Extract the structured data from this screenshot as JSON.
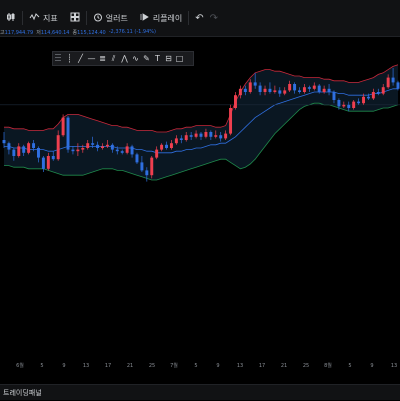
{
  "toolbar": {
    "indicators_label": "지표",
    "alerts_label": "얼러트",
    "replay_label": "리플레이"
  },
  "ohlc": {
    "open_label": "고",
    "open_value": "117,944.79",
    "low_label": "저",
    "low_value": "114,640.14",
    "close_label": "종",
    "close_value": "115,124.40",
    "change": "-2,376.11 (-1.94%)"
  },
  "bottom_panel": {
    "title": "트레이딩패널"
  },
  "colors": {
    "up": "#ef3f4f",
    "down": "#2f6fe0",
    "bb_upper": "#c8283a",
    "bb_lower": "#1f8a4c",
    "bb_basis": "#2f6fe0",
    "bb_fill": "#0b1a26"
  },
  "chart_data": {
    "type": "candlestick",
    "x_tick_labels": [
      "6월",
      "5",
      "9",
      "13",
      "17",
      "21",
      "25",
      "7월",
      "5",
      "9",
      "13",
      "17",
      "21",
      "25",
      "8월",
      "5",
      "9",
      "13"
    ],
    "candles": [
      {
        "o": 50,
        "c": 48,
        "h": 55,
        "l": 45
      },
      {
        "o": 48,
        "c": 44,
        "h": 49,
        "l": 41
      },
      {
        "o": 44,
        "c": 40,
        "h": 45,
        "l": 37
      },
      {
        "o": 40,
        "c": 46,
        "h": 48,
        "l": 39
      },
      {
        "o": 46,
        "c": 42,
        "h": 47,
        "l": 40
      },
      {
        "o": 42,
        "c": 48,
        "h": 49,
        "l": 41
      },
      {
        "o": 48,
        "c": 45,
        "h": 50,
        "l": 43
      },
      {
        "o": 45,
        "c": 39,
        "h": 46,
        "l": 36
      },
      {
        "o": 39,
        "c": 32,
        "h": 40,
        "l": 30
      },
      {
        "o": 32,
        "c": 40,
        "h": 42,
        "l": 31
      },
      {
        "o": 40,
        "c": 38,
        "h": 43,
        "l": 37
      },
      {
        "o": 38,
        "c": 53,
        "h": 56,
        "l": 37
      },
      {
        "o": 53,
        "c": 64,
        "h": 66,
        "l": 52
      },
      {
        "o": 64,
        "c": 44,
        "h": 65,
        "l": 42
      },
      {
        "o": 44,
        "c": 43,
        "h": 46,
        "l": 41
      },
      {
        "o": 43,
        "c": 44,
        "h": 48,
        "l": 40
      },
      {
        "o": 44,
        "c": 45,
        "h": 47,
        "l": 42
      },
      {
        "o": 45,
        "c": 48,
        "h": 50,
        "l": 44
      },
      {
        "o": 48,
        "c": 47,
        "h": 52,
        "l": 45
      },
      {
        "o": 47,
        "c": 45,
        "h": 49,
        "l": 43
      },
      {
        "o": 45,
        "c": 46,
        "h": 48,
        "l": 44
      },
      {
        "o": 46,
        "c": 47,
        "h": 50,
        "l": 45
      },
      {
        "o": 47,
        "c": 44,
        "h": 48,
        "l": 42
      },
      {
        "o": 44,
        "c": 43,
        "h": 46,
        "l": 41
      },
      {
        "o": 43,
        "c": 42,
        "h": 44,
        "l": 41
      },
      {
        "o": 42,
        "c": 46,
        "h": 48,
        "l": 41
      },
      {
        "o": 46,
        "c": 41,
        "h": 47,
        "l": 39
      },
      {
        "o": 41,
        "c": 36,
        "h": 42,
        "l": 35
      },
      {
        "o": 36,
        "c": 31,
        "h": 40,
        "l": 30
      },
      {
        "o": 31,
        "c": 28,
        "h": 33,
        "l": 24
      },
      {
        "o": 28,
        "c": 39,
        "h": 40,
        "l": 26
      },
      {
        "o": 39,
        "c": 44,
        "h": 46,
        "l": 38
      },
      {
        "o": 44,
        "c": 47,
        "h": 48,
        "l": 43
      },
      {
        "o": 47,
        "c": 45,
        "h": 49,
        "l": 44
      },
      {
        "o": 45,
        "c": 48,
        "h": 50,
        "l": 44
      },
      {
        "o": 48,
        "c": 51,
        "h": 53,
        "l": 47
      },
      {
        "o": 51,
        "c": 50,
        "h": 53,
        "l": 48
      },
      {
        "o": 50,
        "c": 53,
        "h": 55,
        "l": 49
      },
      {
        "o": 53,
        "c": 52,
        "h": 55,
        "l": 50
      },
      {
        "o": 52,
        "c": 54,
        "h": 56,
        "l": 51
      },
      {
        "o": 54,
        "c": 52,
        "h": 55,
        "l": 50
      },
      {
        "o": 52,
        "c": 55,
        "h": 57,
        "l": 51
      },
      {
        "o": 55,
        "c": 52,
        "h": 56,
        "l": 50
      },
      {
        "o": 52,
        "c": 53,
        "h": 56,
        "l": 51
      },
      {
        "o": 53,
        "c": 51,
        "h": 55,
        "l": 49
      },
      {
        "o": 51,
        "c": 54,
        "h": 56,
        "l": 50
      },
      {
        "o": 54,
        "c": 70,
        "h": 72,
        "l": 53
      },
      {
        "o": 70,
        "c": 78,
        "h": 80,
        "l": 69
      },
      {
        "o": 78,
        "c": 82,
        "h": 84,
        "l": 76
      },
      {
        "o": 82,
        "c": 80,
        "h": 84,
        "l": 78
      },
      {
        "o": 80,
        "c": 86,
        "h": 88,
        "l": 79
      },
      {
        "o": 86,
        "c": 84,
        "h": 92,
        "l": 82
      },
      {
        "o": 84,
        "c": 80,
        "h": 86,
        "l": 78
      },
      {
        "o": 80,
        "c": 82,
        "h": 84,
        "l": 78
      },
      {
        "o": 82,
        "c": 80,
        "h": 86,
        "l": 79
      },
      {
        "o": 80,
        "c": 81,
        "h": 84,
        "l": 79
      },
      {
        "o": 81,
        "c": 79,
        "h": 83,
        "l": 77
      },
      {
        "o": 79,
        "c": 81,
        "h": 83,
        "l": 78
      },
      {
        "o": 81,
        "c": 85,
        "h": 87,
        "l": 80
      },
      {
        "o": 85,
        "c": 81,
        "h": 86,
        "l": 79
      },
      {
        "o": 81,
        "c": 80,
        "h": 83,
        "l": 79
      },
      {
        "o": 80,
        "c": 83,
        "h": 85,
        "l": 79
      },
      {
        "o": 83,
        "c": 82,
        "h": 84,
        "l": 80
      },
      {
        "o": 82,
        "c": 84,
        "h": 86,
        "l": 81
      },
      {
        "o": 84,
        "c": 80,
        "h": 85,
        "l": 79
      },
      {
        "o": 80,
        "c": 82,
        "h": 84,
        "l": 79
      },
      {
        "o": 82,
        "c": 80,
        "h": 85,
        "l": 78
      },
      {
        "o": 80,
        "c": 75,
        "h": 81,
        "l": 73
      },
      {
        "o": 75,
        "c": 71,
        "h": 76,
        "l": 69
      },
      {
        "o": 71,
        "c": 72,
        "h": 74,
        "l": 70
      },
      {
        "o": 72,
        "c": 70,
        "h": 74,
        "l": 68
      },
      {
        "o": 70,
        "c": 74,
        "h": 75,
        "l": 69
      },
      {
        "o": 74,
        "c": 73,
        "h": 76,
        "l": 72
      },
      {
        "o": 73,
        "c": 77,
        "h": 79,
        "l": 72
      },
      {
        "o": 77,
        "c": 76,
        "h": 79,
        "l": 75
      },
      {
        "o": 76,
        "c": 80,
        "h": 82,
        "l": 75
      },
      {
        "o": 80,
        "c": 79,
        "h": 82,
        "l": 78
      },
      {
        "o": 79,
        "c": 83,
        "h": 85,
        "l": 78
      },
      {
        "o": 83,
        "c": 89,
        "h": 91,
        "l": 82
      },
      {
        "o": 89,
        "c": 86,
        "h": 95,
        "l": 84
      },
      {
        "o": 86,
        "c": 82,
        "h": 87,
        "l": 81
      }
    ],
    "bollinger": {
      "upper": [
        58,
        58,
        57,
        57,
        57,
        56,
        56,
        56,
        56,
        57,
        57,
        60,
        64,
        66,
        66,
        66,
        65,
        64,
        63,
        62,
        61,
        60,
        59,
        59,
        58,
        58,
        57,
        56,
        56,
        56,
        56,
        55,
        55,
        55,
        56,
        57,
        57,
        58,
        58,
        59,
        59,
        59,
        59,
        58,
        58,
        59,
        66,
        74,
        80,
        85,
        89,
        92,
        93,
        94,
        94,
        93,
        93,
        92,
        91,
        90,
        90,
        89,
        89,
        89,
        89,
        88,
        88,
        87,
        87,
        87,
        86,
        86,
        86,
        87,
        88,
        89,
        91,
        92,
        94,
        96,
        97
      ],
      "basis": [
        46,
        46,
        45,
        45,
        45,
        44,
        44,
        44,
        44,
        43,
        43,
        44,
        45,
        46,
        46,
        46,
        46,
        46,
        46,
        46,
        46,
        46,
        46,
        45,
        45,
        45,
        45,
        44,
        44,
        43,
        43,
        42,
        42,
        42,
        42,
        43,
        43,
        44,
        44,
        45,
        45,
        46,
        47,
        47,
        48,
        48,
        50,
        52,
        55,
        58,
        61,
        64,
        66,
        68,
        70,
        72,
        73,
        74,
        75,
        76,
        77,
        78,
        79,
        80,
        80,
        80,
        80,
        80,
        79,
        79,
        78,
        78,
        78,
        78,
        78,
        79,
        79,
        80,
        81,
        82,
        82
      ],
      "lower": [
        34,
        34,
        33,
        33,
        33,
        32,
        32,
        32,
        32,
        31,
        30,
        29,
        28,
        28,
        28,
        28,
        28,
        29,
        30,
        31,
        32,
        32,
        32,
        31,
        31,
        30,
        29,
        28,
        27,
        26,
        25,
        25,
        26,
        27,
        28,
        29,
        30,
        31,
        32,
        33,
        34,
        35,
        36,
        37,
        38,
        38,
        36,
        34,
        32,
        33,
        35,
        38,
        42,
        46,
        50,
        54,
        57,
        60,
        63,
        66,
        69,
        71,
        72,
        73,
        73,
        72,
        72,
        71,
        70,
        69,
        68,
        68,
        68,
        68,
        68,
        68,
        69,
        70,
        70,
        71,
        72
      ]
    },
    "ylim": [
      0,
      100
    ],
    "grid": false
  }
}
